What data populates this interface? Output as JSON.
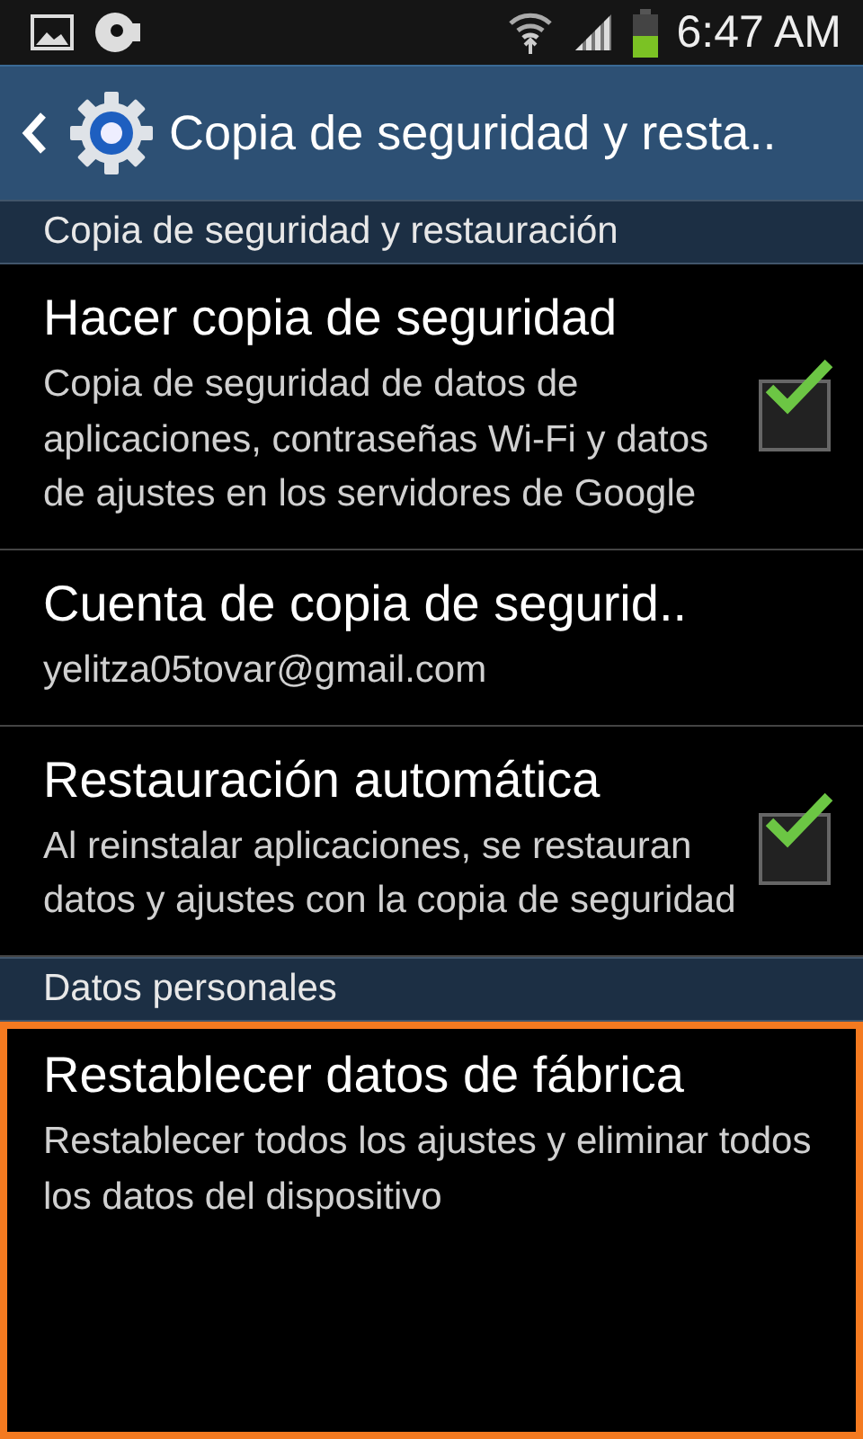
{
  "status_bar": {
    "time": "6:47 AM"
  },
  "action_bar": {
    "title": "Copia de seguridad y resta.."
  },
  "sections": [
    {
      "header": "Copia de seguridad y restauración",
      "items": [
        {
          "kind": "checkbox",
          "title": "Hacer copia de seguridad",
          "summary": "Copia de seguridad de datos de aplicaciones, contraseñas Wi-Fi y datos de ajustes en los servidores de Google",
          "checked": true,
          "highlighted": false
        },
        {
          "kind": "plain",
          "title": "Cuenta de copia de segurid..",
          "summary": "yelitza05tovar@gmail.com",
          "highlighted": false
        },
        {
          "kind": "checkbox",
          "title": "Restauración automática",
          "summary": "Al reinstalar aplicaciones, se restauran datos y ajustes con la copia de seguridad",
          "checked": true,
          "highlighted": false
        }
      ]
    },
    {
      "header": "Datos personales",
      "items": [
        {
          "kind": "plain",
          "title": "Restablecer datos de fábrica",
          "summary": "Restablecer todos los ajustes y eliminar todos los datos del dispositivo",
          "highlighted": true
        }
      ]
    }
  ]
}
